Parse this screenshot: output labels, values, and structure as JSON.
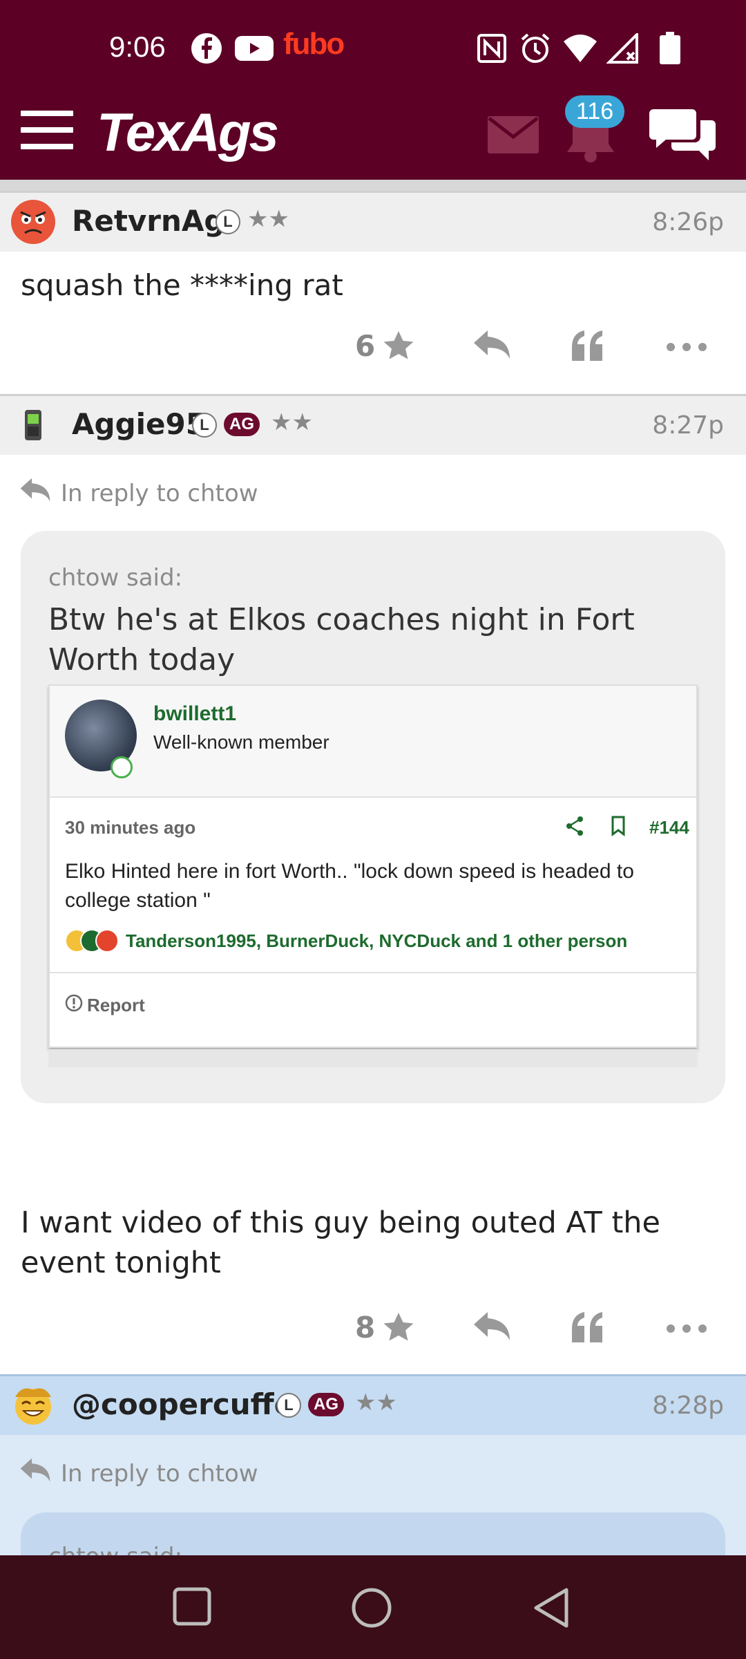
{
  "status_bar": {
    "time": "9:06",
    "app_icons": [
      "facebook-icon",
      "youtube-icon",
      "fubo-icon"
    ],
    "fubo_label": "fubo",
    "system_icons": [
      "nfc-icon",
      "alarm-icon",
      "wifi-icon",
      "signal-icon",
      "battery-icon"
    ]
  },
  "header": {
    "logo": "TexAgs",
    "notification_count": "116"
  },
  "posts": [
    {
      "username": "RetvrnAg",
      "level_badge": "L",
      "stars": "★★",
      "time": "8:26p",
      "body": "squash the ****ing rat",
      "star_count": "6"
    },
    {
      "username": "Aggie95",
      "level_badge": "L",
      "ag_badge": "AG",
      "stars": "★★",
      "time": "8:27p",
      "reply_to": "In reply to chtow",
      "quote": {
        "said": "chtow said:",
        "text": "Btw he's at Elkos coaches night in Fort Worth today",
        "embed": {
          "author": "bwillett1",
          "role": "Well-known member",
          "ago": "30 minutes ago",
          "post_number": "#144",
          "body": "Elko Hinted here in fort Worth.. \"lock down speed is headed to college station \"",
          "reactions": "Tanderson1995, BurnerDuck, NYCDuck and 1 other person",
          "report": "Report"
        }
      },
      "body": "I want video of this guy being outed AT the event tonight",
      "star_count": "8"
    },
    {
      "username": "@coopercuffe",
      "level_badge": "L",
      "ag_badge": "AG",
      "stars": "★★",
      "time": "8:28p",
      "reply_to": "In reply to chtow",
      "quote_said": "chtow said:"
    }
  ],
  "colors": {
    "brand_maroon": "#5c0026",
    "nav_bg": "#3b0d18",
    "badge_blue": "#3aa6d8",
    "highlight_blue": "#c6dcf2",
    "embed_green": "#1d6b2e"
  }
}
